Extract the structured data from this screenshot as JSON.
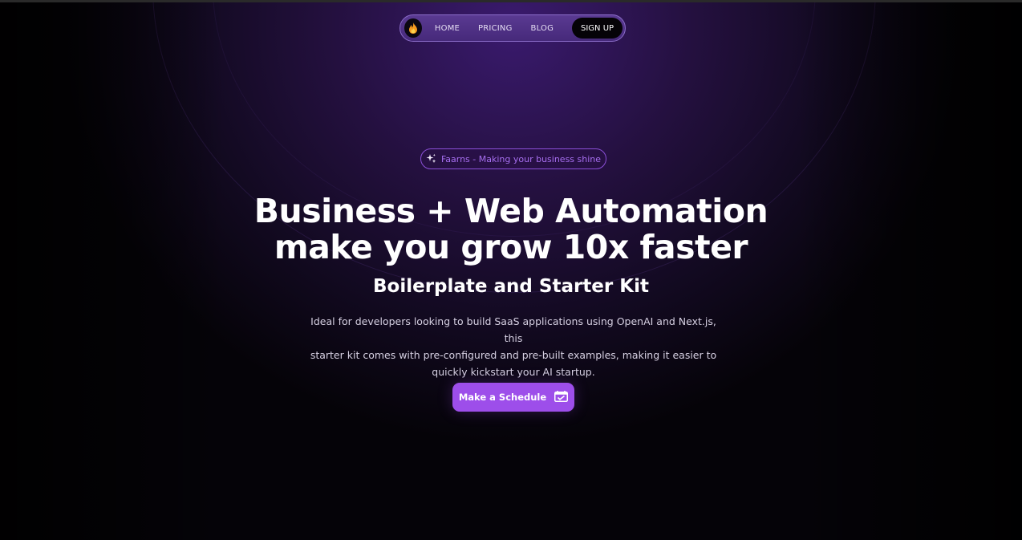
{
  "nav": {
    "logo_icon": "flame-icon",
    "links": [
      "HOME",
      "PRICING",
      "BLOG"
    ],
    "signup_label": "SIGN UP"
  },
  "badge": {
    "icon": "sparkles-icon",
    "text": "Faarns - Making your business shine"
  },
  "hero": {
    "title_line1": "Business + Web Automation",
    "title_line2": "make you grow 10x faster",
    "subtitle": "Boilerplate and Starter Kit",
    "description_line1": "Ideal for developers looking to build SaaS applications using OpenAI and Next.js, this",
    "description_line2": "starter kit comes with pre-configured and pre-built examples, making it easier to",
    "description_line3": "quickly kickstart your AI startup."
  },
  "cta": {
    "label": "Make a Schedule",
    "icon": "calendar-check-icon"
  },
  "colors": {
    "accent": "#9d4eea",
    "badge_text": "#a76ff0",
    "nav_bg": "#4e2f85"
  }
}
